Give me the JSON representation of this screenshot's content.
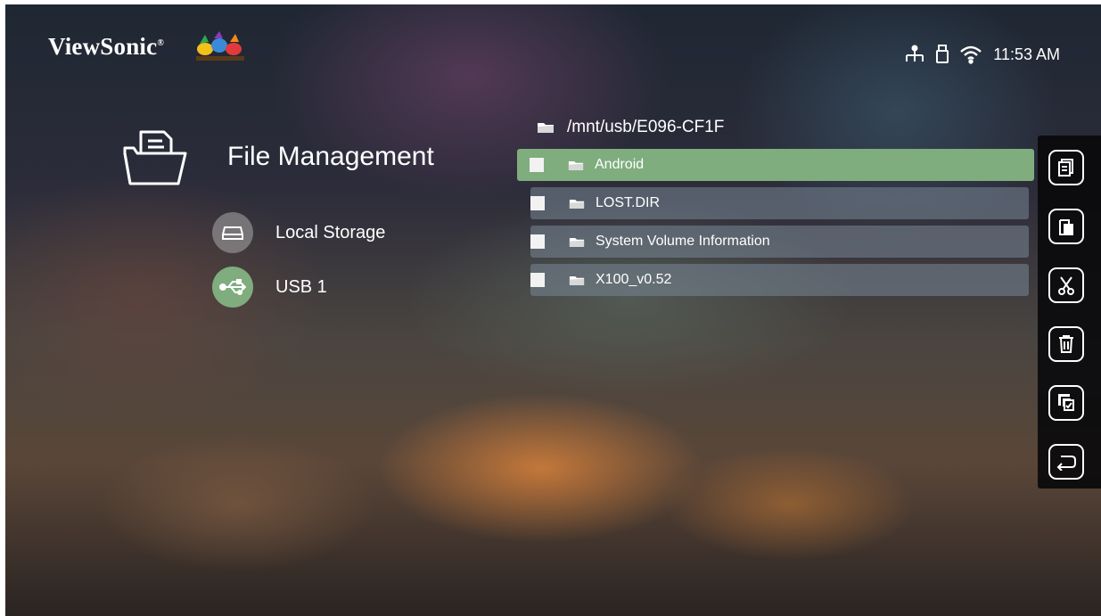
{
  "brand": {
    "name": "ViewSonic",
    "logo_icon": "viewsonic-birds-icon"
  },
  "status_bar": {
    "icons": [
      "network-icon",
      "usb-icon",
      "wifi-icon"
    ],
    "time": "11:53 AM"
  },
  "header": {
    "title": "File Management",
    "icon": "folder-file-icon"
  },
  "sources": [
    {
      "label": "Local Storage",
      "icon": "storage-drive-icon",
      "selected": false
    },
    {
      "label": "USB 1",
      "icon": "usb-icon",
      "selected": true
    }
  ],
  "path": "/mnt/usb/E096-CF1F",
  "files": [
    {
      "name": "Android",
      "selected": true
    },
    {
      "name": "LOST.DIR",
      "selected": false
    },
    {
      "name": "System Volume Information",
      "selected": false
    },
    {
      "name": "X100_v0.52",
      "selected": false
    }
  ],
  "toolbar": {
    "actions": [
      "copy-icon",
      "paste-icon",
      "cut-icon",
      "delete-icon",
      "select-all-icon",
      "back-icon"
    ]
  },
  "colors": {
    "accent": "#7fad7e",
    "row_bg": "rgba(120,135,150,0.55)",
    "usb_circle": "#7fad7e",
    "toolbar_bg": "#0a0a0c"
  }
}
